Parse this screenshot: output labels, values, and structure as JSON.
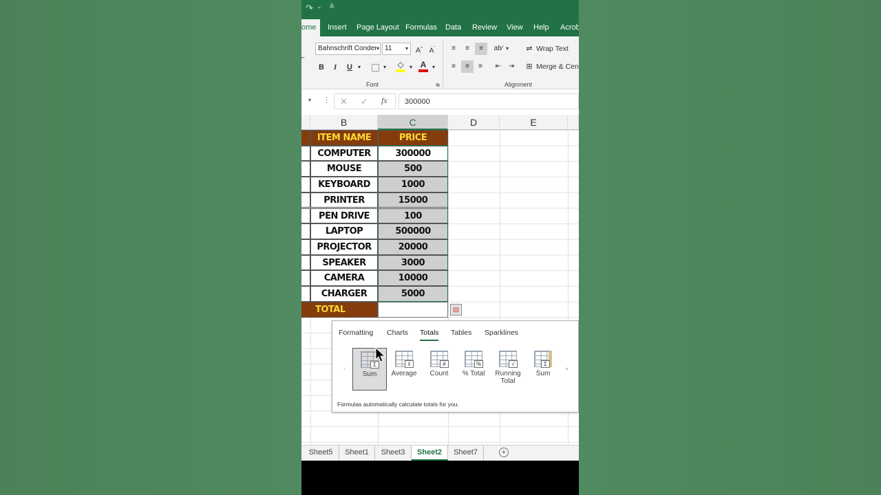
{
  "quick_access": {
    "redo_icon": "redo-icon",
    "more_icon": "customize-icon"
  },
  "ribbon_tabs": [
    "ome",
    "Insert",
    "Page Layout",
    "Formulas",
    "Data",
    "Review",
    "View",
    "Help",
    "Acrob"
  ],
  "font": {
    "name": "Bahnschrift Conder",
    "size": "11",
    "grow": "A",
    "shrink": "A",
    "bold": "B",
    "italic": "I",
    "underline": "U",
    "font_color": "A",
    "group_label": "Font"
  },
  "alignment": {
    "wrap_text": "Wrap Text",
    "merge": "Merge & Cent",
    "group_label": "Alignment"
  },
  "formula_bar": {
    "fx": "fx",
    "value": "300000"
  },
  "columns": [
    "B",
    "C",
    "D",
    "E"
  ],
  "table": {
    "headers": [
      "ITEM NAME",
      "PRICE"
    ],
    "rows": [
      [
        "COMPUTER",
        "300000"
      ],
      [
        "MOUSE",
        "500"
      ],
      [
        "KEYBOARD",
        "1000"
      ],
      [
        "PRINTER",
        "15000"
      ],
      [
        "PEN DRIVE",
        "100"
      ],
      [
        "LAPTOP",
        "500000"
      ],
      [
        "PROJECTOR",
        "20000"
      ],
      [
        "SPEAKER",
        "3000"
      ],
      [
        "CAMERA",
        "10000"
      ],
      [
        "CHARGER",
        "5000"
      ]
    ],
    "total_label": "TOTAL"
  },
  "quick_analysis": {
    "tabs": [
      "Formatting",
      "Charts",
      "Totals",
      "Tables",
      "Sparklines"
    ],
    "active_tab": "Totals",
    "items": [
      {
        "label": "Sum",
        "symbol": "Σ"
      },
      {
        "label": "Average",
        "symbol": "x̄"
      },
      {
        "label": "Count",
        "symbol": "#"
      },
      {
        "label": "% Total",
        "symbol": "%"
      },
      {
        "label": "Running Total",
        "symbol": "√"
      },
      {
        "label": "Sum",
        "symbol": "Σ"
      }
    ],
    "description": "Formulas automatically calculate totals for you."
  },
  "sheets": [
    "Sheet5",
    "Sheet1",
    "Sheet3",
    "Sheet2",
    "Sheet7"
  ],
  "active_sheet": "Sheet2",
  "colors": {
    "excel_green": "#217346",
    "header_fill": "#843c0c",
    "header_text": "#ffd932",
    "selection_fill": "#cfcfcf",
    "background": "#4e855d"
  }
}
